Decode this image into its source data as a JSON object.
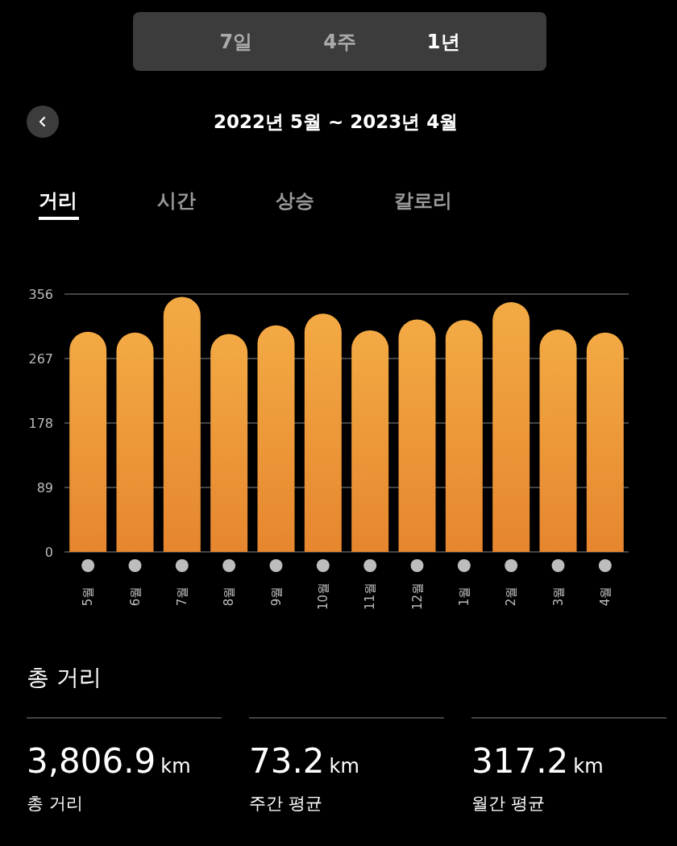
{
  "period_tabs": [
    {
      "label": "7일",
      "selected": false
    },
    {
      "label": "4주",
      "selected": false
    },
    {
      "label": "1년",
      "selected": true
    }
  ],
  "date_range": "2022년 5월 ~ 2023년 4월",
  "metric_tabs": [
    {
      "label": "거리",
      "selected": true
    },
    {
      "label": "시간",
      "selected": false
    },
    {
      "label": "상승",
      "selected": false
    },
    {
      "label": "칼로리",
      "selected": false
    }
  ],
  "chart": {
    "chart_data": {
      "type": "bar",
      "categories": [
        "5월",
        "6월",
        "7월",
        "8월",
        "9월",
        "10월",
        "11월",
        "12월",
        "1월",
        "2월",
        "3월",
        "4월"
      ],
      "values": [
        304,
        303,
        352,
        301,
        313,
        329,
        306,
        321,
        320,
        345,
        307,
        303
      ],
      "grid": true,
      "ylim": [
        0,
        356
      ],
      "yticks": [
        0,
        89,
        178,
        267,
        356
      ]
    }
  },
  "summary": {
    "title": "총 거리",
    "stats": [
      {
        "value": "3,806.9",
        "unit": "km",
        "label": "총 거리"
      },
      {
        "value": "73.2",
        "unit": "km",
        "label": "주간 평균"
      },
      {
        "value": "317.2",
        "unit": "km",
        "label": "월간 평균"
      }
    ]
  }
}
